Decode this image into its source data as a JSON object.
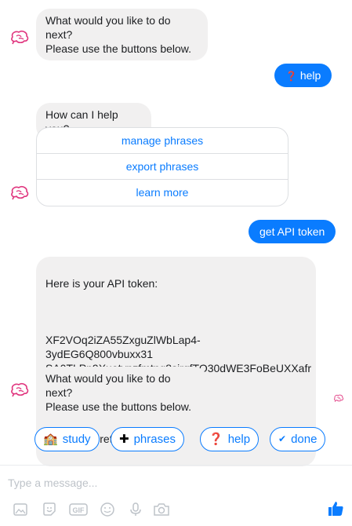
{
  "messages": {
    "m1": "What would you like to do next?\nPlease use the buttons below.",
    "m2_user": "help",
    "m2_user_icon": "❓",
    "m3": "How can I help you?",
    "m3_buttons": [
      "manage phrases",
      "export phrases",
      "learn more"
    ],
    "m4_user": "get API token",
    "m5_line1": "Here is your API token:",
    "m5_token": "XF2VOq2iZA55ZxguZlWbLap4-3ydEG6Q800vbuxx31\nSA0TLPp9Xuatypzfmtng8sjrqfTO30dWE3FoBeUXXafr\nLoCXjxi5R-62ms2tOQ=",
    "m5_line3": "Keep it secret!",
    "m6": "What would you like to do next?\nPlease use the buttons below."
  },
  "quick_replies": [
    {
      "icon": "🏫",
      "label": "study"
    },
    {
      "icon": "✚",
      "label": "phrases"
    },
    {
      "icon": "❓",
      "label": "help"
    },
    {
      "icon": "✔",
      "label": "done"
    }
  ],
  "composer": {
    "placeholder": "Type a message..."
  },
  "toolbar_icons": [
    "image-icon",
    "sticker-icon",
    "gif-icon",
    "emoji-icon",
    "microphone-icon",
    "camera-icon",
    "like-icon"
  ],
  "colors": {
    "accent": "#0a7cff",
    "bot_bubble": "#f1f0f0",
    "avatar": "#e0357e"
  }
}
